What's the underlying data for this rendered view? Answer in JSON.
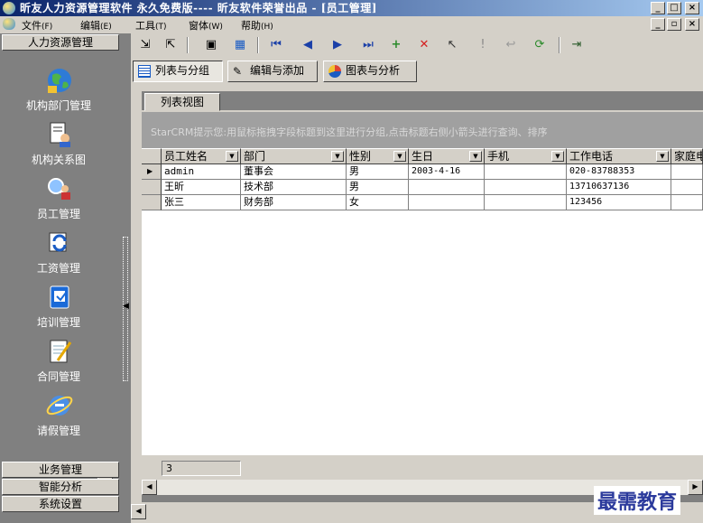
{
  "window": {
    "title": "昕友人力资源管理软件 永久免费版---- 昕友软件荣誉出品 - [员工管理]",
    "minimize": "_",
    "maximize": "□",
    "close": "×"
  },
  "menu": {
    "items": [
      {
        "label": "文件",
        "key": "(F)"
      },
      {
        "label": "编辑",
        "key": "(E)"
      },
      {
        "label": "工具",
        "key": "(T)"
      },
      {
        "label": "窗体",
        "key": "(W)"
      },
      {
        "label": "帮助",
        "key": "(H)"
      }
    ]
  },
  "sidebar": {
    "header": "人力资源管理",
    "items": [
      {
        "label": "机构部门管理",
        "icon": "globe-icon"
      },
      {
        "label": "机构关系图",
        "icon": "document-person-icon"
      },
      {
        "label": "员工管理",
        "icon": "magnifier-person-icon"
      },
      {
        "label": "工资管理",
        "icon": "refresh-arrows-icon"
      },
      {
        "label": "培训管理",
        "icon": "notebook-icon"
      },
      {
        "label": "合同管理",
        "icon": "notepad-pencil-icon"
      },
      {
        "label": "请假管理",
        "icon": "internet-explorer-icon"
      }
    ],
    "bottom_sections": [
      "业务管理",
      "智能分析",
      "系统设置"
    ]
  },
  "view_tabs": {
    "tabs": [
      "列表与分组",
      "编辑与添加",
      "图表与分析"
    ],
    "active": 0
  },
  "subtab": "列表视图",
  "group_hint": "StarCRM提示您:用鼠标拖拽字段标题到这里进行分组,点击标题右侧小箭头进行查询、排序",
  "grid": {
    "columns": [
      "员工姓名",
      "部门",
      "性别",
      "生日",
      "手机",
      "工作电话",
      "家庭电话"
    ],
    "rows": [
      [
        "admin",
        "董事会",
        "男",
        "2003-4-16",
        "",
        "020-83788353",
        ""
      ],
      [
        "王昕",
        "技术部",
        "男",
        "",
        "",
        "13710637136",
        ""
      ],
      [
        "张三",
        "财务部",
        "女",
        "",
        "",
        "123456",
        ""
      ]
    ],
    "current_row_marker": "▶",
    "dropdown_glyph": "▼"
  },
  "footer": {
    "count": "3"
  },
  "watermark": "最需教育",
  "colors": {
    "title_start": "#0a246a",
    "title_end": "#a6caf0",
    "sidebar_bg": "#808080",
    "accent": "#2b3a9c"
  }
}
